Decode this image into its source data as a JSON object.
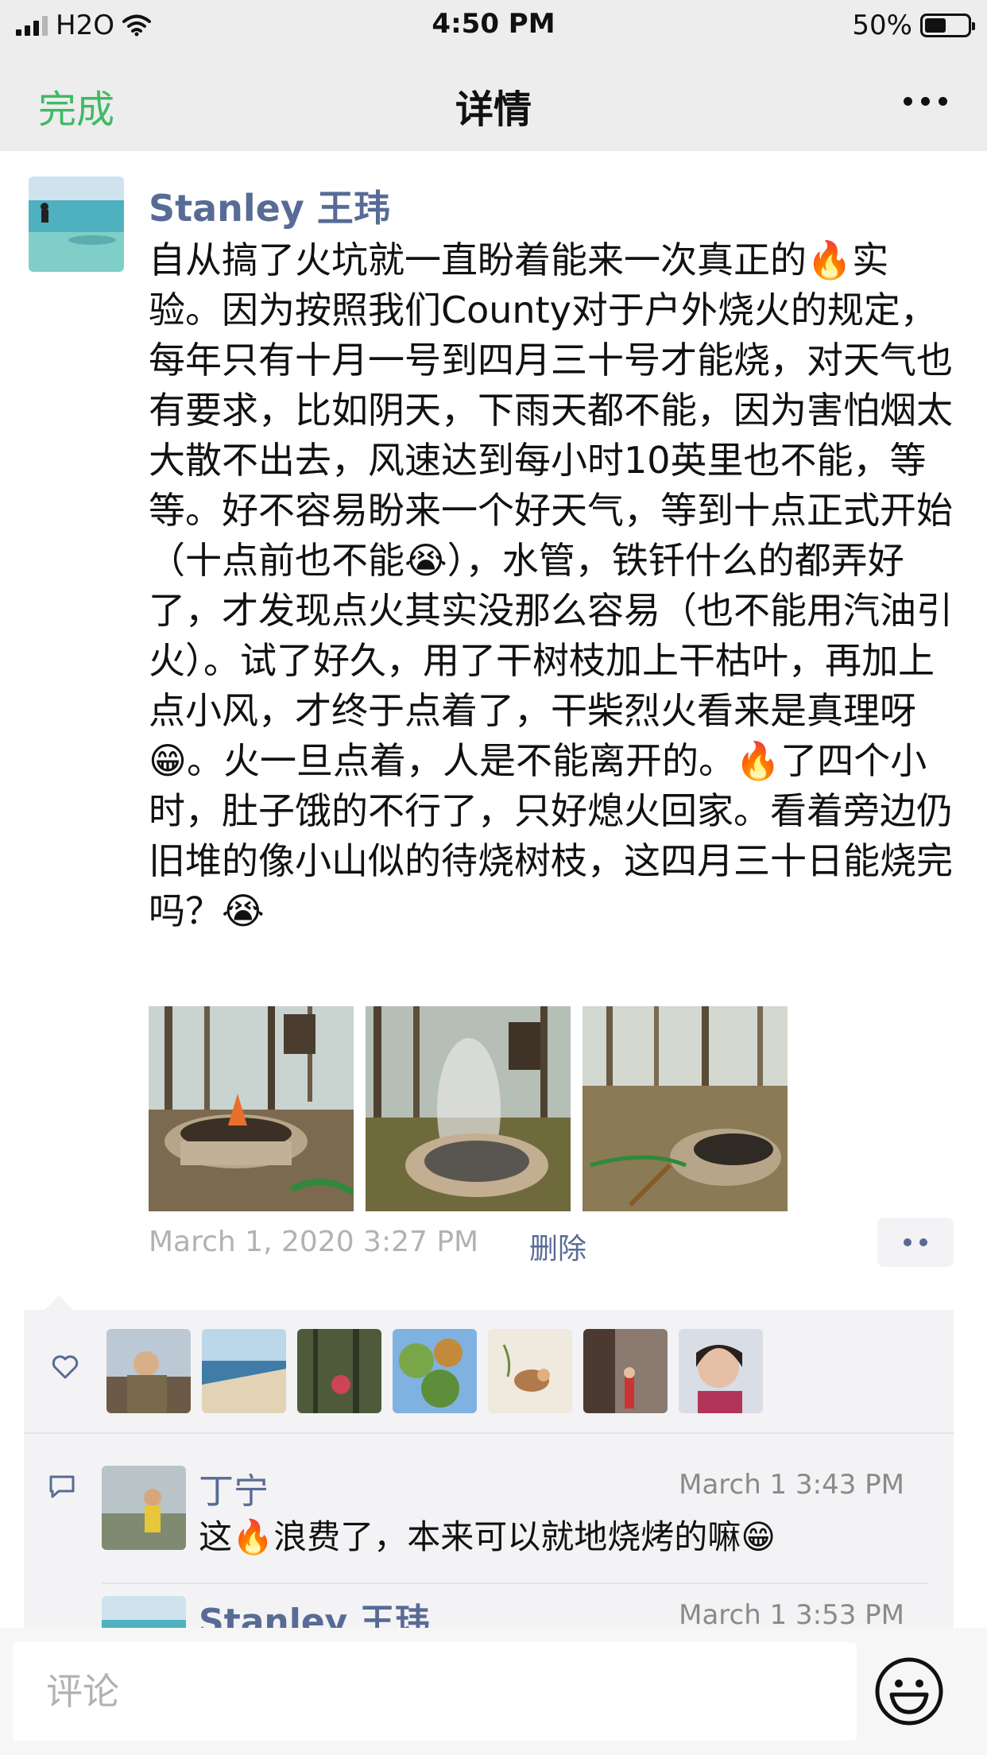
{
  "status_bar": {
    "carrier": "H2O",
    "time": "4:50 PM",
    "battery_text": "50%",
    "battery_level": 0.5,
    "wifi_icon": "wifi-icon",
    "signal_icon": "signal-icon"
  },
  "nav": {
    "done_label": "完成",
    "title": "详情",
    "more_icon": "more-dots-icon"
  },
  "post": {
    "author": "Stanley 王玮",
    "text": "自从搞了火坑就一直盼着能来一次真正的🔥实验。因为按照我们County对于户外烧火的规定，每年只有十月一号到四月三十号才能烧，对天气也有要求，比如阴天，下雨天都不能，因为害怕烟太大散不出去，风速达到每小时10英里也不能，等等。好不容易盼来一个好天气，等到十点正式开始（十点前也不能😭），水管，铁钎什么的都弄好了，才发现点火其实没那么容易（也不能用汽油引火）。试了好久，用了干树枝加上干枯叶，再加上点小风，才终于点着了，干柴烈火看来是真理呀😁。火一旦点着，人是不能离开的。🔥了四个小时，肚子饿的不行了，只好熄火回家。看着旁边仍旧堆的像小山似的待烧树枝，这四月三十日能烧完吗？😭",
    "photos": [
      "fire-pit-photo-1",
      "fire-pit-photo-2",
      "fire-pit-photo-3"
    ],
    "time": "March 1, 2020 3:27 PM",
    "delete_label": "删除"
  },
  "likes": {
    "icon": "heart-icon",
    "avatars": [
      "liker-avatar-1",
      "liker-avatar-2",
      "liker-avatar-3",
      "liker-avatar-4",
      "liker-avatar-5",
      "liker-avatar-6",
      "liker-avatar-7"
    ]
  },
  "comments": [
    {
      "name": "丁宁",
      "time": "March 1 3:43 PM",
      "text": "这🔥浪费了，本来可以就地烧烤的嘛😁"
    },
    {
      "name": "Stanley 王玮",
      "time": "March 1 3:53 PM",
      "text": ""
    }
  ],
  "comment_bar": {
    "placeholder": "评论",
    "emoji_icon": "emoji-smile-icon"
  },
  "colors": {
    "accent_green": "#3fba63",
    "link_blue": "#576b95",
    "nav_bg": "#ededed",
    "panel_bg": "#f3f3f5"
  }
}
